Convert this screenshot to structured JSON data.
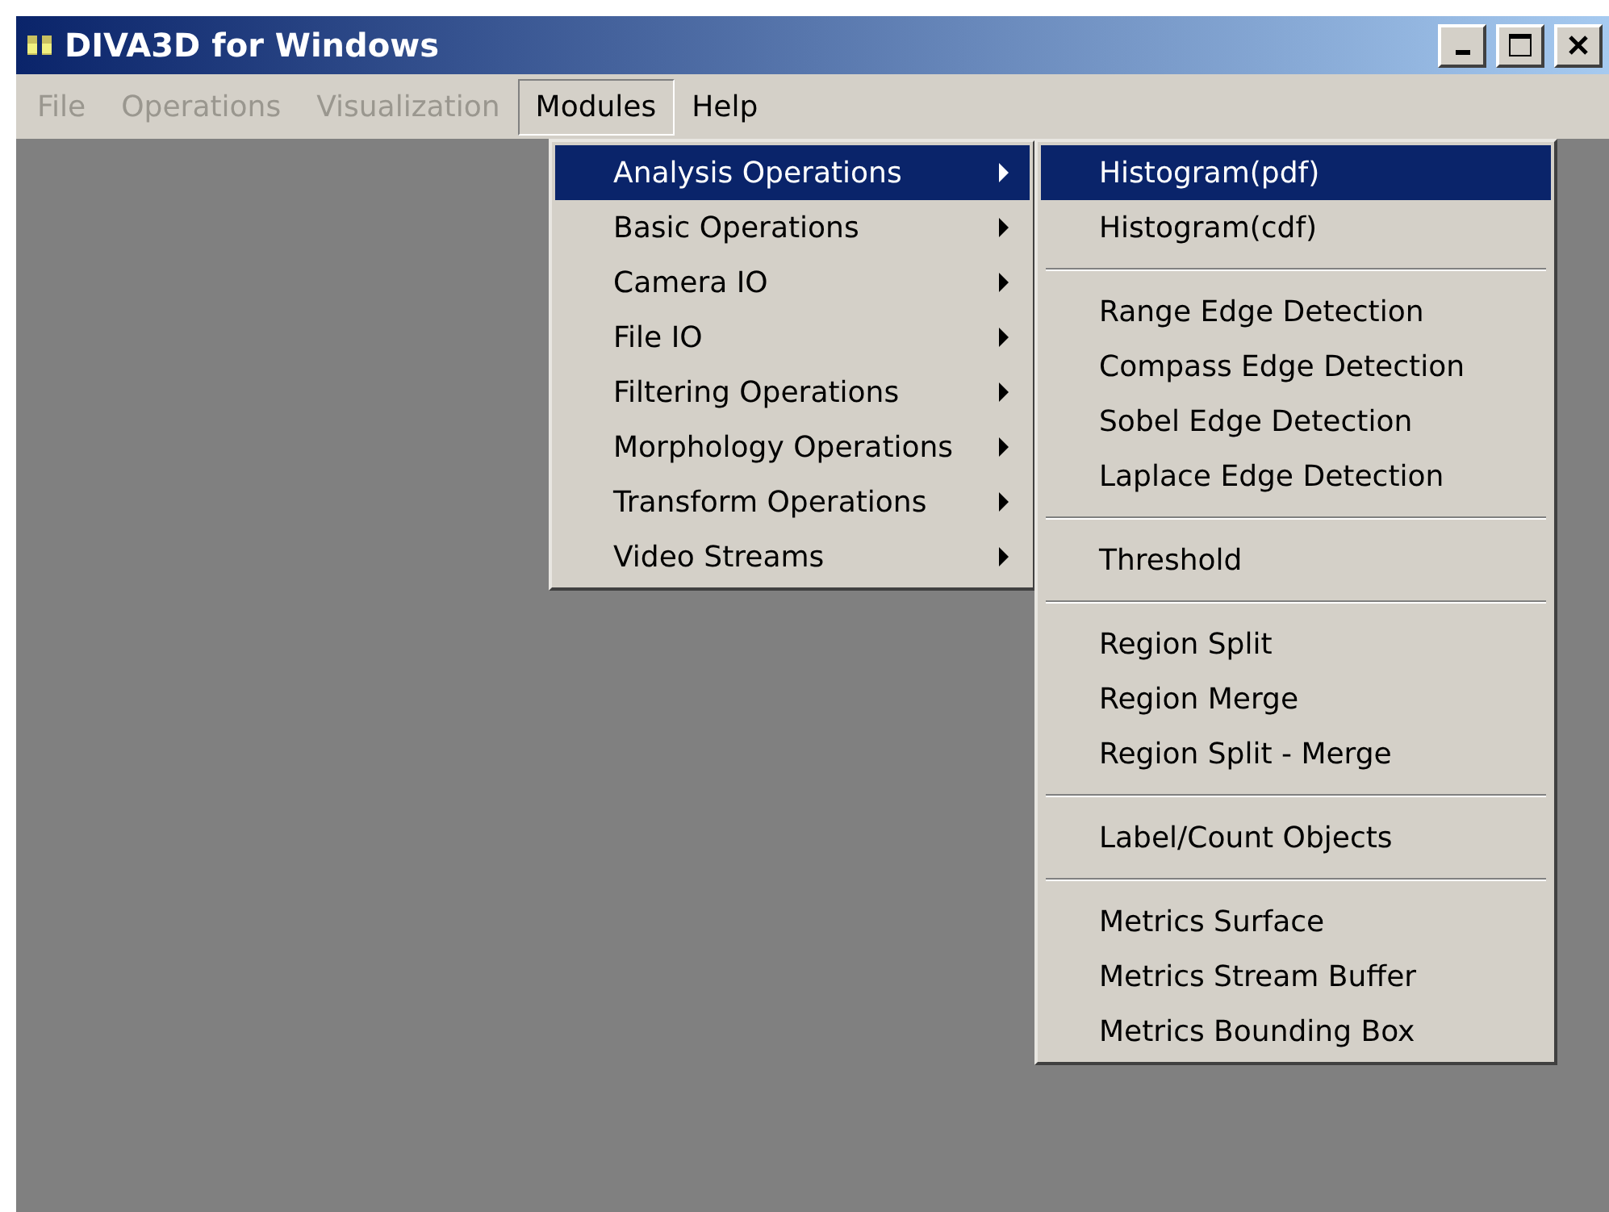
{
  "window": {
    "title": "DIVA3D for Windows"
  },
  "menubar": [
    {
      "label": "File",
      "disabled": true,
      "selected": false
    },
    {
      "label": "Operations",
      "disabled": true,
      "selected": false
    },
    {
      "label": "Visualization",
      "disabled": true,
      "selected": false
    },
    {
      "label": "Modules",
      "disabled": false,
      "selected": true
    },
    {
      "label": "Help",
      "disabled": false,
      "selected": false
    }
  ],
  "menu": [
    {
      "label": "Analysis Operations",
      "selected": true
    },
    {
      "label": "Basic Operations",
      "selected": false
    },
    {
      "label": "Camera IO",
      "selected": false
    },
    {
      "label": "File IO",
      "selected": false
    },
    {
      "label": "Filtering Operations",
      "selected": false
    },
    {
      "label": "Morphology Operations",
      "selected": false
    },
    {
      "label": "Transform Operations",
      "selected": false
    },
    {
      "label": "Video Streams",
      "selected": false
    }
  ],
  "submenu": [
    {
      "kind": "item",
      "label": "Histogram(pdf)",
      "selected": true
    },
    {
      "kind": "item",
      "label": "Histogram(cdf)",
      "selected": false
    },
    {
      "kind": "separator"
    },
    {
      "kind": "item",
      "label": "Range Edge Detection",
      "selected": false
    },
    {
      "kind": "item",
      "label": "Compass Edge Detection",
      "selected": false
    },
    {
      "kind": "item",
      "label": "Sobel Edge Detection",
      "selected": false
    },
    {
      "kind": "item",
      "label": "Laplace Edge Detection",
      "selected": false
    },
    {
      "kind": "separator"
    },
    {
      "kind": "item",
      "label": "Threshold",
      "selected": false
    },
    {
      "kind": "separator"
    },
    {
      "kind": "item",
      "label": "Region Split",
      "selected": false
    },
    {
      "kind": "item",
      "label": "Region Merge",
      "selected": false
    },
    {
      "kind": "item",
      "label": "Region Split - Merge",
      "selected": false
    },
    {
      "kind": "separator"
    },
    {
      "kind": "item",
      "label": "Label/Count Objects",
      "selected": false
    },
    {
      "kind": "separator"
    },
    {
      "kind": "item",
      "label": "Metrics Surface",
      "selected": false
    },
    {
      "kind": "item",
      "label": "Metrics Stream Buffer",
      "selected": false
    },
    {
      "kind": "item",
      "label": "Metrics Bounding Box",
      "selected": false
    }
  ]
}
